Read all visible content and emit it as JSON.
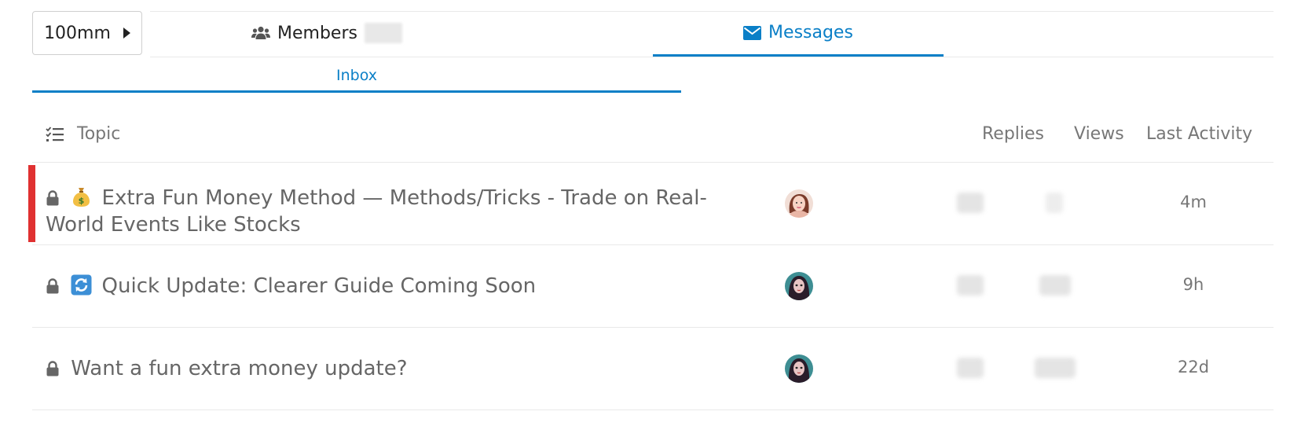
{
  "header": {
    "user_button_label": "100mm",
    "tabs": [
      {
        "label": "Members",
        "icon": "users-icon"
      },
      {
        "label": "Messages",
        "icon": "envelope-icon",
        "active": true
      }
    ],
    "subtab": {
      "label": "Inbox",
      "active": true
    }
  },
  "list": {
    "columns": {
      "topic": "Topic",
      "replies": "Replies",
      "views": "Views",
      "last_activity": "Last Activity"
    },
    "rows": [
      {
        "title": "Extra Fun Money Method — Methods/Tricks - Trade on Real-World Events Like Stocks",
        "emoji": "money-bag-icon",
        "locked": true,
        "highlighted": true,
        "last_activity": "4m"
      },
      {
        "title": "Quick Update: Clearer Guide Coming Soon",
        "emoji": "arrows-refresh-icon",
        "locked": true,
        "highlighted": false,
        "last_activity": "9h"
      },
      {
        "title": "Want a fun extra money update?",
        "emoji": "",
        "locked": true,
        "highlighted": false,
        "last_activity": "22d"
      }
    ]
  },
  "colors": {
    "accent": "#0a7fc7",
    "highlight": "#e03131",
    "muted_text": "#777777"
  }
}
